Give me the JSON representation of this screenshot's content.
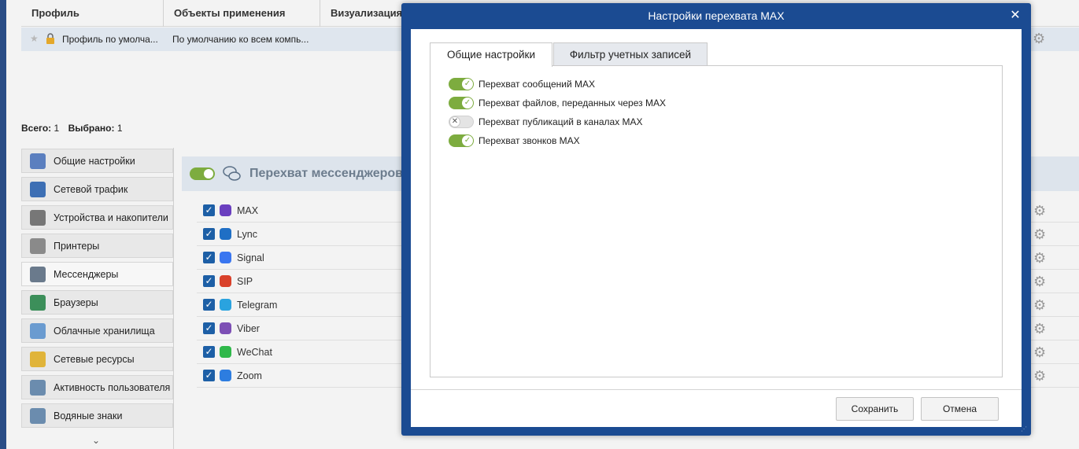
{
  "background": {
    "table_header": [
      "Профиль",
      "Объекты применения",
      "Визуализация"
    ],
    "profile_row": {
      "name": "Профиль по умолча...",
      "scope": "По умолчанию ко всем компь..."
    },
    "counts": {
      "total_label": "Всего:",
      "total": "1",
      "selected_label": "Выбрано:",
      "selected": "1"
    },
    "sidebar": {
      "items": [
        {
          "label": "Общие настройки",
          "icon": "settings-badge-icon",
          "color": "#5b7fbf"
        },
        {
          "label": "Сетевой трафик",
          "icon": "network-traffic-icon",
          "color": "#3d6fb4"
        },
        {
          "label": "Устройства и накопители",
          "icon": "devices-icon",
          "color": "#777777"
        },
        {
          "label": "Принтеры",
          "icon": "printer-icon",
          "color": "#8a8a8a"
        },
        {
          "label": "Мессенджеры",
          "icon": "chat-bubbles-icon",
          "color": "#6a7a8c"
        },
        {
          "label": "Браузеры",
          "icon": "globe-icon",
          "color": "#3c8f5a"
        },
        {
          "label": "Облачные хранилища",
          "icon": "cloud-icon",
          "color": "#6a9bd0"
        },
        {
          "label": "Сетевые ресурсы",
          "icon": "folder-icon",
          "color": "#e0b43a"
        },
        {
          "label": "Активность пользователя",
          "icon": "monitor-clock-icon",
          "color": "#6b8cae"
        },
        {
          "label": "Водяные знаки",
          "icon": "watermark-monitor-icon",
          "color": "#6b8cae"
        }
      ],
      "active_index": 4
    },
    "main": {
      "title": "Перехват мессенджеров",
      "messengers": [
        {
          "label": "MAX",
          "icon": "max-icon",
          "color": "#6a3fbf"
        },
        {
          "label": "Lync",
          "icon": "lync-icon",
          "color": "#1f6fc5"
        },
        {
          "label": "Signal",
          "icon": "signal-icon",
          "color": "#3a76f0"
        },
        {
          "label": "SIP",
          "icon": "phone-icon",
          "color": "#d9412b"
        },
        {
          "label": "Telegram",
          "icon": "telegram-icon",
          "color": "#2aa3df"
        },
        {
          "label": "Viber",
          "icon": "viber-icon",
          "color": "#7d4fb5"
        },
        {
          "label": "WeChat",
          "icon": "wechat-icon",
          "color": "#2fb84a"
        },
        {
          "label": "Zoom",
          "icon": "zoom-icon",
          "color": "#2d7de0"
        }
      ]
    }
  },
  "modal": {
    "title": "Настройки перехвата MAX",
    "tabs": [
      {
        "label": "Общие настройки",
        "active": true
      },
      {
        "label": "Фильтр учетных записей",
        "active": false
      }
    ],
    "options": [
      {
        "label": "Перехват сообщений MAX",
        "enabled": true
      },
      {
        "label": "Перехват файлов, переданных через MAX",
        "enabled": true
      },
      {
        "label": "Перехват публикаций в каналах MAX",
        "enabled": false
      },
      {
        "label": "Перехват звонков MAX",
        "enabled": true
      }
    ],
    "buttons": {
      "save": "Сохранить",
      "cancel": "Отмена"
    },
    "accent_color": "#1b4b92",
    "toggle_on_color": "#7dac3f"
  }
}
